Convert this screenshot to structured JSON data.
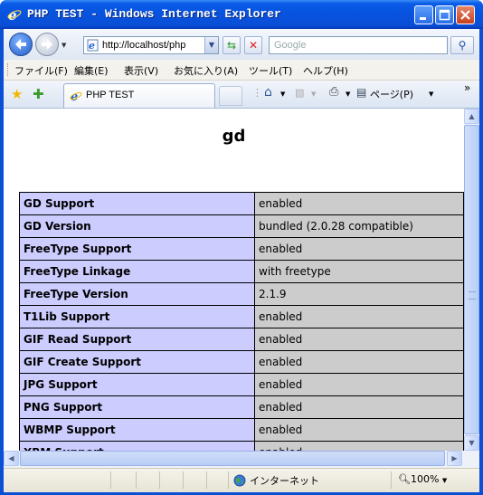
{
  "window": {
    "title": "PHP TEST - Windows Internet Explorer"
  },
  "address": {
    "url": "http://localhost/php"
  },
  "search": {
    "placeholder": "Google"
  },
  "menu": [
    "ファイル(F)",
    "編集(E)",
    "表示(V)",
    "お気に入り(A)",
    "ツール(T)",
    "ヘルプ(H)"
  ],
  "tab": {
    "label": "PHP TEST"
  },
  "commandbar": {
    "page_label": "ページ(P)",
    "overflow": "»"
  },
  "page": {
    "heading": "gd",
    "rows": [
      {
        "name": "GD Support",
        "value": "enabled"
      },
      {
        "name": "GD Version",
        "value": "bundled (2.0.28 compatible)"
      },
      {
        "name": "FreeType Support",
        "value": "enabled"
      },
      {
        "name": "FreeType Linkage",
        "value": "with freetype"
      },
      {
        "name": "FreeType Version",
        "value": "2.1.9"
      },
      {
        "name": "T1Lib Support",
        "value": "enabled"
      },
      {
        "name": "GIF Read Support",
        "value": "enabled"
      },
      {
        "name": "GIF Create Support",
        "value": "enabled"
      },
      {
        "name": "JPG Support",
        "value": "enabled"
      },
      {
        "name": "PNG Support",
        "value": "enabled"
      },
      {
        "name": "WBMP Support",
        "value": "enabled"
      },
      {
        "name": "XBM Support",
        "value": "enabled"
      }
    ]
  },
  "status": {
    "zone": "インターネット",
    "zoom": "100%"
  },
  "colors": {
    "entry_bg": "#ccccff",
    "value_bg": "#cccccc",
    "titlebar": "#0a4ed6"
  }
}
